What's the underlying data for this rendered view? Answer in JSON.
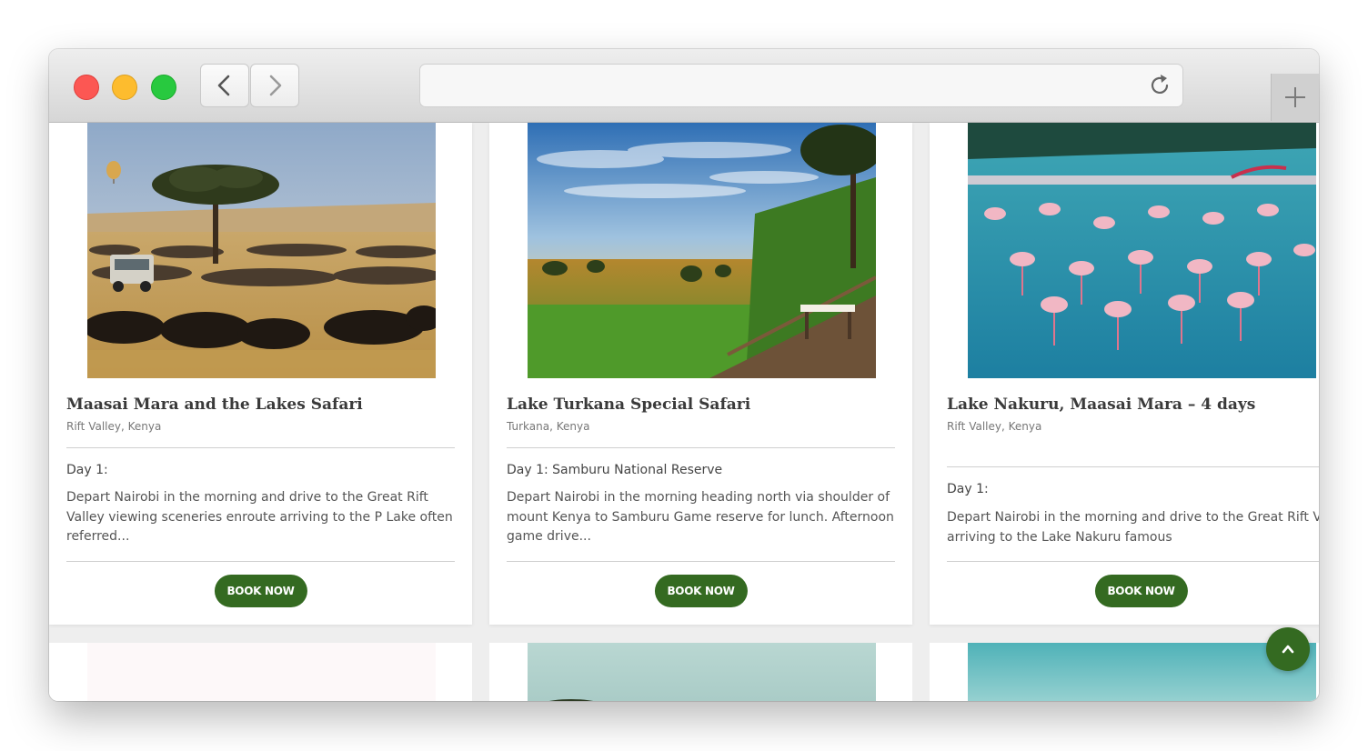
{
  "browser": {
    "url": "",
    "icons": {
      "back": "chevron-left-icon",
      "forward": "chevron-right-icon",
      "reload": "reload-icon",
      "new_tab": "plus-icon"
    }
  },
  "tours": [
    {
      "title": "Maasai Mara and the Lakes Safari",
      "location": "Rift Valley, Kenya",
      "day": "Day 1:",
      "description": "Depart Nairobi in the morning and drive to the Great Rift Valley viewing sceneries enroute arriving to the P Lake often referred...",
      "button": "BOOK NOW",
      "image": "savanna with acacia tree, wildebeest herd, safari jeep and hot-air balloon"
    },
    {
      "title": "Lake Turkana Special Safari",
      "location": "Turkana, Kenya",
      "day": "Day 1: Samburu National Reserve",
      "description": "Depart Nairobi in the morning heading north via shoulder of mount Kenya to Samburu Game reserve for lunch. Afternoon game drive...",
      "button": "BOOK NOW",
      "image": "sunset over green plains seen from a wooden deck with a dining table"
    },
    {
      "title": "Lake Nakuru, Maasai Mara – 4 days",
      "location": "Rift Valley, Kenya",
      "day": "Day 1:",
      "description": "Depart Nairobi in the morning and drive to the Great Rift Valley viewing sceneries enroute arriving to the Lake Nakuru famous",
      "button": "BOOK NOW",
      "image": "flock of pink flamingos wading in turquoise lake water"
    }
  ],
  "scroll_top_icon": "chevron-up-icon",
  "colors": {
    "accent": "#346a21",
    "close": "#fc5753",
    "minimize": "#fdbc2e",
    "maximize": "#28c93f"
  }
}
